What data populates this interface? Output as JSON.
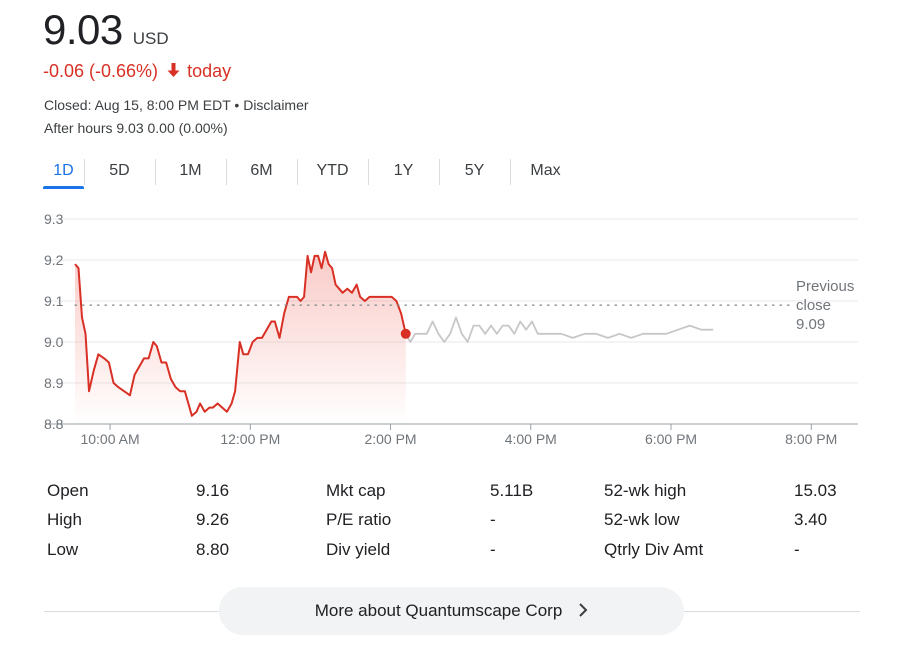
{
  "quote": {
    "price": "9.03",
    "currency": "USD",
    "change_text": "-0.06 (-0.66%)",
    "change_period": "today",
    "closed_text": "Closed: Aug 15, 8:00 PM EDT",
    "disclaimer_text": "Disclaimer",
    "after_hours_text": "After hours 9.03 0.00 (0.00%)"
  },
  "tabs": [
    "1D",
    "5D",
    "1M",
    "6M",
    "YTD",
    "1Y",
    "5Y",
    "Max"
  ],
  "active_tab": "1D",
  "colors": {
    "negative": "#d93025",
    "accent": "#1a73e8",
    "afterhours_line": "#c7c7c7",
    "gridline": "#e8eaed"
  },
  "chart_data": {
    "type": "line",
    "ylim": [
      8.8,
      9.3
    ],
    "yticks": [
      "9.3",
      "9.2",
      "9.1",
      "9.0",
      "8.9",
      "8.8"
    ],
    "xlim": [
      "9:30",
      "20:40"
    ],
    "xticks": [
      {
        "t": "10:00",
        "label": "10:00 AM"
      },
      {
        "t": "12:00",
        "label": "12:00 PM"
      },
      {
        "t": "14:00",
        "label": "2:00 PM"
      },
      {
        "t": "16:00",
        "label": "4:00 PM"
      },
      {
        "t": "18:00",
        "label": "6:00 PM"
      },
      {
        "t": "20:00",
        "label": "8:00 PM"
      }
    ],
    "previous_close": {
      "value": 9.09,
      "label_lines": [
        "Previous",
        "close",
        "9.09"
      ]
    },
    "series": [
      {
        "points": [
          [
            "9:30",
            9.19
          ],
          [
            "9:33",
            9.18
          ],
          [
            "9:36",
            9.06
          ],
          [
            "9:39",
            9.02
          ],
          [
            "9:42",
            8.88
          ],
          [
            "9:46",
            8.93
          ],
          [
            "9:50",
            8.97
          ],
          [
            "9:55",
            8.96
          ],
          [
            "9:59",
            8.95
          ],
          [
            "10:03",
            8.9
          ],
          [
            "10:07",
            8.89
          ],
          [
            "10:12",
            8.88
          ],
          [
            "10:17",
            8.87
          ],
          [
            "10:21",
            8.92
          ],
          [
            "10:25",
            8.94
          ],
          [
            "10:29",
            8.96
          ],
          [
            "10:33",
            8.96
          ],
          [
            "10:37",
            9.0
          ],
          [
            "10:40",
            8.99
          ],
          [
            "10:44",
            8.95
          ],
          [
            "10:48",
            8.95
          ],
          [
            "10:52",
            8.91
          ],
          [
            "10:56",
            8.89
          ],
          [
            "11:00",
            8.88
          ],
          [
            "11:04",
            8.88
          ],
          [
            "11:10",
            8.82
          ],
          [
            "11:14",
            8.83
          ],
          [
            "11:17",
            8.85
          ],
          [
            "11:21",
            8.83
          ],
          [
            "11:25",
            8.84
          ],
          [
            "11:28",
            8.84
          ],
          [
            "11:32",
            8.85
          ],
          [
            "11:36",
            8.84
          ],
          [
            "11:40",
            8.83
          ],
          [
            "11:44",
            8.85
          ],
          [
            "11:47",
            8.88
          ],
          [
            "11:51",
            9.0
          ],
          [
            "11:54",
            8.97
          ],
          [
            "11:58",
            8.97
          ],
          [
            "12:02",
            9.0
          ],
          [
            "12:06",
            9.01
          ],
          [
            "12:10",
            9.01
          ],
          [
            "12:14",
            9.03
          ],
          [
            "12:18",
            9.05
          ],
          [
            "12:21",
            9.05
          ],
          [
            "12:25",
            9.01
          ],
          [
            "12:29",
            9.07
          ],
          [
            "12:33",
            9.11
          ],
          [
            "12:37",
            9.11
          ],
          [
            "12:40",
            9.11
          ],
          [
            "12:43",
            9.1
          ],
          [
            "12:46",
            9.11
          ],
          [
            "12:49",
            9.21
          ],
          [
            "12:52",
            9.17
          ],
          [
            "12:55",
            9.21
          ],
          [
            "12:58",
            9.21
          ],
          [
            "13:01",
            9.18
          ],
          [
            "13:04",
            9.22
          ],
          [
            "13:07",
            9.19
          ],
          [
            "13:10",
            9.18
          ],
          [
            "13:13",
            9.14
          ],
          [
            "13:16",
            9.13
          ],
          [
            "13:19",
            9.12
          ],
          [
            "13:23",
            9.13
          ],
          [
            "13:27",
            9.12
          ],
          [
            "13:31",
            9.14
          ],
          [
            "13:34",
            9.11
          ],
          [
            "13:38",
            9.1
          ],
          [
            "13:42",
            9.11
          ],
          [
            "13:46",
            9.11
          ],
          [
            "13:50",
            9.11
          ],
          [
            "13:54",
            9.11
          ],
          [
            "13:58",
            9.11
          ],
          [
            "14:01",
            9.11
          ],
          [
            "14:05",
            9.1
          ],
          [
            "14:09",
            9.07
          ],
          [
            "14:13",
            9.02
          ]
        ]
      },
      {
        "points": [
          [
            "14:13",
            9.02
          ],
          [
            "14:17",
            9.0
          ],
          [
            "14:21",
            9.02
          ],
          [
            "14:26",
            9.02
          ],
          [
            "14:31",
            9.02
          ],
          [
            "14:36",
            9.05
          ],
          [
            "14:41",
            9.02
          ],
          [
            "14:46",
            9.0
          ],
          [
            "14:51",
            9.02
          ],
          [
            "14:56",
            9.06
          ],
          [
            "15:01",
            9.02
          ],
          [
            "15:06",
            9.0
          ],
          [
            "15:11",
            9.04
          ],
          [
            "15:16",
            9.04
          ],
          [
            "15:21",
            9.02
          ],
          [
            "15:26",
            9.04
          ],
          [
            "15:31",
            9.02
          ],
          [
            "15:36",
            9.04
          ],
          [
            "15:41",
            9.04
          ],
          [
            "15:46",
            9.02
          ],
          [
            "15:51",
            9.05
          ],
          [
            "15:56",
            9.03
          ],
          [
            "16:01",
            9.05
          ],
          [
            "16:06",
            9.02
          ],
          [
            "16:16",
            9.02
          ],
          [
            "16:26",
            9.02
          ],
          [
            "16:36",
            9.01
          ],
          [
            "16:46",
            9.02
          ],
          [
            "16:56",
            9.02
          ],
          [
            "17:06",
            9.01
          ],
          [
            "17:16",
            9.02
          ],
          [
            "17:26",
            9.01
          ],
          [
            "17:36",
            9.02
          ],
          [
            "17:46",
            9.02
          ],
          [
            "17:56",
            9.02
          ],
          [
            "18:06",
            9.03
          ],
          [
            "18:16",
            9.04
          ],
          [
            "18:26",
            9.03
          ],
          [
            "18:36",
            9.03
          ]
        ]
      }
    ]
  },
  "stats": [
    [
      {
        "label": "Open",
        "value": "9.16"
      },
      {
        "label": "Mkt cap",
        "value": "5.11B"
      },
      {
        "label": "52-wk high",
        "value": "15.03"
      }
    ],
    [
      {
        "label": "High",
        "value": "9.26"
      },
      {
        "label": "P/E ratio",
        "value": "-"
      },
      {
        "label": "52-wk low",
        "value": "3.40"
      }
    ],
    [
      {
        "label": "Low",
        "value": "8.80"
      },
      {
        "label": "Div yield",
        "value": "-"
      },
      {
        "label": "Qtrly Div Amt",
        "value": "-"
      }
    ]
  ],
  "more_button": {
    "label": "More about Quantumscape Corp",
    "icon": "chevron-right-icon"
  }
}
